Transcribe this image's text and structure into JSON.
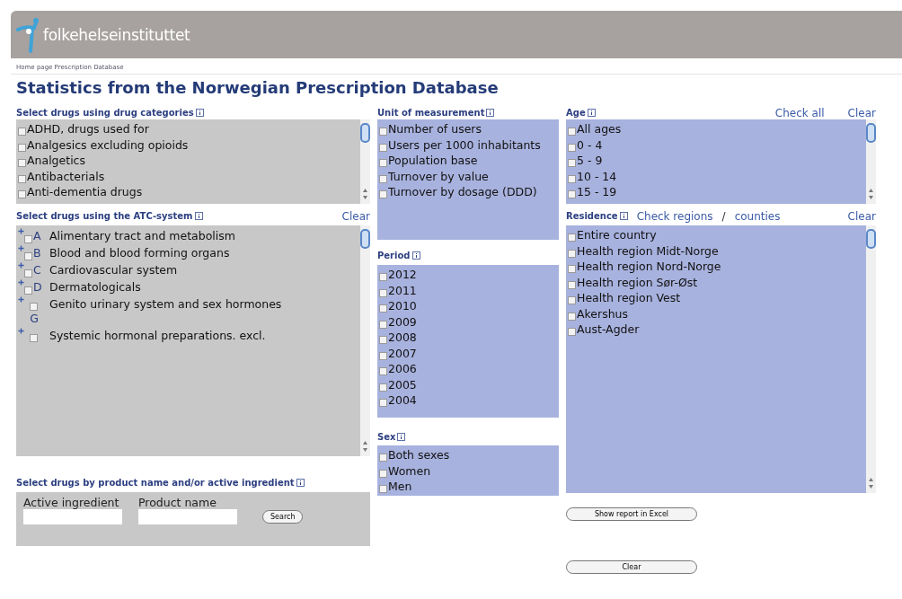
{
  "header": {
    "logo_text": "folkehelseinstituttet"
  },
  "breadcrumb": "Home page Prescription Database",
  "title": "Statistics from the Norwegian Prescription Database",
  "drug_categories": {
    "label": "Select drugs using drug categories",
    "items": [
      {
        "label": "ADHD, drugs used for",
        "checked": false
      },
      {
        "label": "Analgesics excluding opioids",
        "checked": false
      },
      {
        "label": "Analgetics",
        "checked": false
      },
      {
        "label": "Antibacterials",
        "checked": false
      },
      {
        "label": "Anti-dementia drugs",
        "checked": false
      }
    ]
  },
  "atc": {
    "label": "Select drugs using the ATC-system",
    "clear": "Clear",
    "items": [
      {
        "code": "A",
        "label": "Alimentary tract and metabolism",
        "checked": false
      },
      {
        "code": "B",
        "label": "Blood and blood forming organs",
        "checked": false
      },
      {
        "code": "C",
        "label": "Cardiovascular system",
        "checked": false
      },
      {
        "code": "D",
        "label": "Dermatologicals",
        "checked": false
      },
      {
        "code": "G",
        "label": "Genito urinary system and sex hormones",
        "checked": false
      },
      {
        "label": "Systemic hormonal preparations. excl.",
        "checked": false
      }
    ]
  },
  "product": {
    "label": "Select drugs by product name and/or active ingredient",
    "fields": [
      {
        "label": "Active ingredient"
      },
      {
        "label": "Product name"
      }
    ],
    "button": "Search"
  },
  "unit": {
    "label": "Unit of measurement",
    "items": [
      {
        "label": "Number of users",
        "checked": false
      },
      {
        "label": "Users per 1000 inhabitants",
        "checked": false
      },
      {
        "label": "Population base",
        "checked": false
      },
      {
        "label": "Turnover by value",
        "checked": false
      },
      {
        "label": "Turnover by dosage (DDD)",
        "checked": false
      }
    ]
  },
  "period": {
    "label": "Period",
    "items": [
      {
        "label": "2012",
        "checked": false
      },
      {
        "label": "2011",
        "checked": false
      },
      {
        "label": "2010",
        "checked": false
      },
      {
        "label": "2009",
        "checked": false
      },
      {
        "label": "2008",
        "checked": false
      },
      {
        "label": "2007",
        "checked": false
      },
      {
        "label": "2006",
        "checked": false
      },
      {
        "label": "2005",
        "checked": false
      },
      {
        "label": "2004",
        "checked": false
      }
    ]
  },
  "sex": {
    "label": "Sex",
    "items": [
      {
        "label": "Both sexes",
        "checked": false
      },
      {
        "label": "Women",
        "checked": false
      },
      {
        "label": "Men",
        "checked": false
      }
    ]
  },
  "age": {
    "label": "Age",
    "check_all": "Check all",
    "clear": "Clear",
    "items": [
      {
        "label": "All ages",
        "checked": false
      },
      {
        "label": "0 - 4",
        "checked": false
      },
      {
        "label": "5 - 9",
        "checked": false
      },
      {
        "label": "10 - 14",
        "checked": false
      },
      {
        "label": "15 - 19",
        "checked": false
      }
    ]
  },
  "residence": {
    "label": "Residence",
    "check_regions": "Check regions",
    "separator": "/",
    "check_counties": "counties",
    "clear": "Clear",
    "items": [
      {
        "label": "Entire country",
        "checked": false
      },
      {
        "label": "Health region Midt-Norge",
        "checked": false
      },
      {
        "label": "Health region Nord-Norge",
        "checked": false
      },
      {
        "label": "Health region Sør-Øst",
        "checked": false
      },
      {
        "label": "Health region Vest",
        "checked": false
      },
      {
        "label": "Akershus",
        "checked": false
      },
      {
        "label": "Aust-Agder",
        "checked": false
      }
    ]
  },
  "buttons": [
    {
      "label": "Show report in Excel"
    },
    {
      "label": "Clear"
    }
  ]
}
